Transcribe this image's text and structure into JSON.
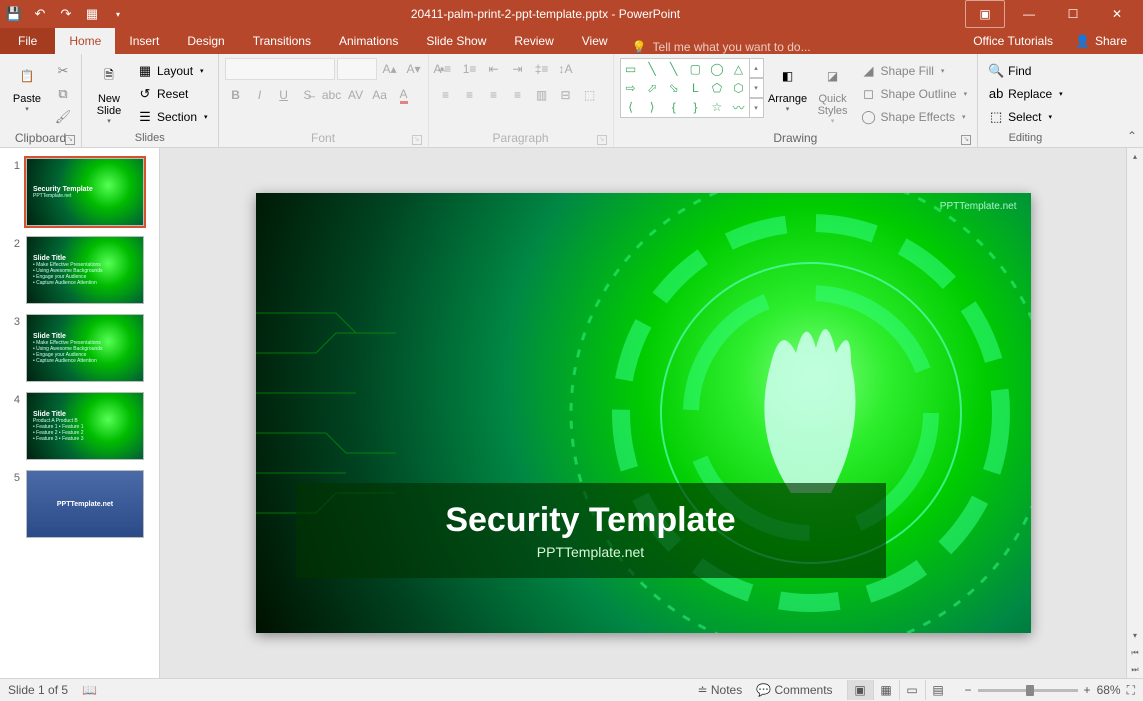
{
  "app": {
    "title_doc": "20411-palm-print-2-ppt-template.pptx",
    "title_app": "PowerPoint"
  },
  "tabs": {
    "file": "File",
    "home": "Home",
    "insert": "Insert",
    "design": "Design",
    "transitions": "Transitions",
    "animations": "Animations",
    "slideshow": "Slide Show",
    "review": "Review",
    "view": "View",
    "tellme": "Tell me what you want to do...",
    "tutorials": "Office Tutorials",
    "share": "Share"
  },
  "ribbon": {
    "clipboard": {
      "label": "Clipboard",
      "paste": "Paste",
      "cut": "Cut",
      "copy": "Copy",
      "fmt": "Format Painter"
    },
    "slides": {
      "label": "Slides",
      "new": "New\nSlide",
      "layout": "Layout",
      "reset": "Reset",
      "section": "Section"
    },
    "font": {
      "label": "Font"
    },
    "paragraph": {
      "label": "Paragraph"
    },
    "drawing": {
      "label": "Drawing",
      "arrange": "Arrange",
      "quick": "Quick\nStyles",
      "fill": "Shape Fill",
      "outline": "Shape Outline",
      "effects": "Shape Effects"
    },
    "editing": {
      "label": "Editing",
      "find": "Find",
      "replace": "Replace",
      "select": "Select"
    }
  },
  "thumbs": [
    {
      "n": "1",
      "title": "Security Template",
      "sub": "PPTTemplate.net"
    },
    {
      "n": "2",
      "title": "Slide Title",
      "sub": "• Make Effective Presentations\n• Using Awesome Backgrounds\n• Engage your Audience\n• Capture Audience Attention"
    },
    {
      "n": "3",
      "title": "Slide Title",
      "sub": "• Make Effective Presentations\n• Using Awesome Backgrounds\n• Engage your Audience\n• Capture Audience Attention"
    },
    {
      "n": "4",
      "title": "Slide Title",
      "sub": "Product A   Product B\n• Feature 1  • Feature 1\n• Feature 2  • Feature 2\n• Feature 3  • Feature 3"
    },
    {
      "n": "5",
      "title": "PPTTemplate.net",
      "sub": ""
    }
  ],
  "slide": {
    "watermark": "PPTTemplate.net",
    "title": "Security Template",
    "subtitle": "PPTTemplate.net"
  },
  "status": {
    "slide": "Slide 1 of 5",
    "notes": "Notes",
    "comments": "Comments",
    "zoom": "68%"
  }
}
